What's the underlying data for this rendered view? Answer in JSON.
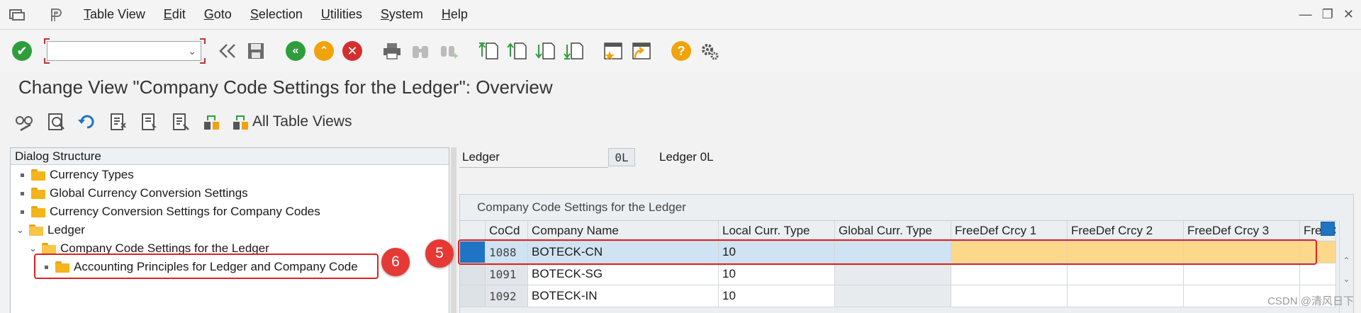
{
  "menubar": {
    "items": [
      "Table View",
      "Edit",
      "Goto",
      "Selection",
      "Utilities",
      "System",
      "Help"
    ]
  },
  "toolbar": {
    "command_field_value": "",
    "icons": [
      "enter-icon",
      "command-field",
      "collapse-toolbar-icon",
      "save-icon",
      "back-icon",
      "exit-icon",
      "cancel-icon",
      "print-icon",
      "find-icon",
      "find-next-icon",
      "first-page-icon",
      "previous-page-icon",
      "next-page-icon",
      "last-page-icon",
      "create-session-icon",
      "generate-shortcut-icon",
      "help-icon",
      "layout-menu-icon"
    ]
  },
  "page": {
    "title": "Change View \"Company Code Settings for the Ledger\": Overview"
  },
  "app_toolbar": {
    "all_table_views_label": "All Table Views"
  },
  "dialog_structure": {
    "header": "Dialog Structure",
    "items": [
      {
        "label": "Currency Types",
        "level": 0
      },
      {
        "label": "Global Currency Conversion Settings",
        "level": 0
      },
      {
        "label": "Currency Conversion Settings for Company Codes",
        "level": 0
      },
      {
        "label": "Ledger",
        "level": 0,
        "expanded": true
      },
      {
        "label": "Company Code Settings for the Ledger",
        "level": 1,
        "expanded": true
      },
      {
        "label": "Accounting Principles for Ledger and Company Code",
        "level": 2
      }
    ]
  },
  "callouts": {
    "step5": "5",
    "step6": "6"
  },
  "ledger": {
    "label": "Ledger",
    "value": "0L",
    "description": "Ledger 0L"
  },
  "table": {
    "title": "Company Code Settings for the Ledger",
    "columns": [
      "CoCd",
      "Company Name",
      "Local Curr. Type",
      "Global Curr. Type",
      "FreeDef Crcy 1",
      "FreeDef Crcy 2",
      "FreeDef Crcy 3",
      "FreeDe"
    ],
    "rows": [
      {
        "cocd": "1088",
        "company_name": "BOTECK-CN",
        "local_curr_type": "10",
        "global_curr_type": "",
        "selected": true
      },
      {
        "cocd": "1091",
        "company_name": "BOTECK-SG",
        "local_curr_type": "10",
        "global_curr_type": ""
      },
      {
        "cocd": "1092",
        "company_name": "BOTECK-IN",
        "local_curr_type": "10",
        "global_curr_type": ""
      }
    ]
  },
  "watermark": "CSDN @清风日下",
  "colors": {
    "accent_blue": "#1f74c4",
    "selection_row": "#cfe3f2",
    "free_cells_highlight": "#fcd88a",
    "annotation_red": "#e02020"
  }
}
